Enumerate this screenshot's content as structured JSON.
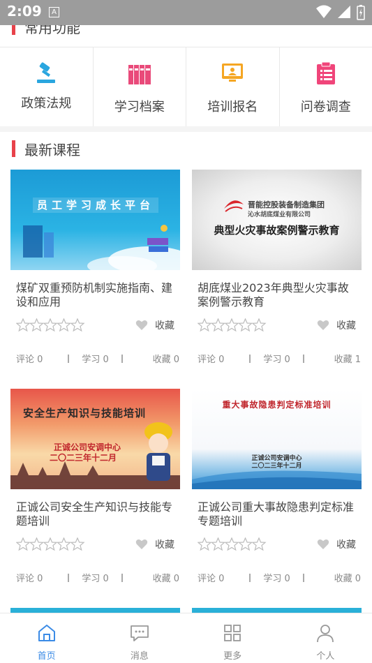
{
  "status_bar": {
    "time": "2:09",
    "notification_badge": "A"
  },
  "sections": {
    "common": {
      "title": "常用功能"
    },
    "latest": {
      "title": "最新课程"
    }
  },
  "functions": [
    {
      "label": "政策法规",
      "icon": "gavel-icon"
    },
    {
      "label": "学习档案",
      "icon": "archive-icon"
    },
    {
      "label": "培训报名",
      "icon": "presentation-icon"
    },
    {
      "label": "问卷调查",
      "icon": "clipboard-icon"
    }
  ],
  "courses": [
    {
      "title": "煤矿双重预防机制实施指南、建设和应用",
      "image_text": "员工学习成长平台",
      "favorite_label": "收藏",
      "comments": "评论 0",
      "studies": "学习 0",
      "favorites": "收藏 0"
    },
    {
      "title": "胡底煤业2023年典型火灾事故案例警示教育",
      "image_text": "典型火灾事故案例警示教育",
      "image_org": "晋能控股装备制造集团",
      "image_sub": "沁水胡底煤业有限公司",
      "favorite_label": "收藏",
      "comments": "评论 0",
      "studies": "学习 0",
      "favorites": "收藏 1"
    },
    {
      "title": "正诚公司安全生产知识与技能专题培训",
      "image_text": "安全生产知识与技能培训",
      "image_sub1": "正诚公司安调中心",
      "image_sub2": "二〇二三年十二月",
      "favorite_label": "收藏",
      "comments": "评论 0",
      "studies": "学习 0",
      "favorites": "收藏 0"
    },
    {
      "title": "正诚公司重大事故隐患判定标准专题培训",
      "image_text": "重大事故隐患判定标准培训",
      "image_sub1": "正诚公司安调中心",
      "image_sub2": "二〇二三年十二月",
      "favorite_label": "收藏",
      "comments": "评论 0",
      "studies": "学习 0",
      "favorites": "收藏 0"
    }
  ],
  "bottom_nav": [
    {
      "label": "首页",
      "icon": "home-icon",
      "active": true
    },
    {
      "label": "消息",
      "icon": "message-icon"
    },
    {
      "label": "更多",
      "icon": "grid-icon"
    },
    {
      "label": "个人",
      "icon": "user-icon"
    }
  ],
  "colors": {
    "accent": "#e8424a",
    "active": "#3b8be6"
  }
}
